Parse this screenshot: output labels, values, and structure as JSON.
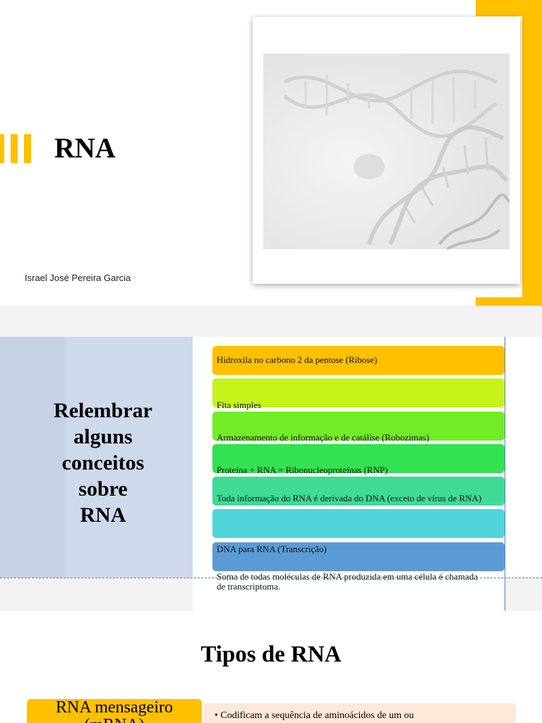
{
  "slide1": {
    "title": "RNA",
    "author": "Israel José Pereira Garcia",
    "accent_color": "#FFC000",
    "image": "dna-helix-image"
  },
  "slide2": {
    "heading_lines": [
      "Relembrar",
      "alguns",
      "conceitos",
      "sobre",
      "RNA"
    ],
    "items": [
      {
        "text": "Hidroxila no carbono 2 da pentose (Ribose)",
        "color": "#FFC000"
      },
      {
        "text": "Fita simples",
        "color": "#C6F31A"
      },
      {
        "text": "Armazenamento de informação e de catálise (Robozimas)",
        "color": "#72EC24"
      },
      {
        "text": "Proteína + RNA = Ribonucleoproteínas (RNP)",
        "color": "#33E250"
      },
      {
        "text": "Toda informação do RNA é derivada do DNA (exceto de vírus de RNA)",
        "color": "#3EDB95"
      },
      {
        "text": "",
        "color": "#4FD6DA"
      },
      {
        "text": "DNA para RNA (Transcrição)",
        "color": "#5B9BD5"
      },
      {
        "text": "Soma de todas moléculas de RNA produzida em uma célula é chamada de transcriptoma.",
        "color": ""
      }
    ]
  },
  "slide3": {
    "title": "Tipos de RNA",
    "type_label": "RNA mensageiro (mRNA)",
    "type_label_line1": "RNA mensageiro",
    "type_label_line2": "(mRNA)",
    "desc_bullet": "Codificam a sequência de aminoácidos de um ou"
  }
}
